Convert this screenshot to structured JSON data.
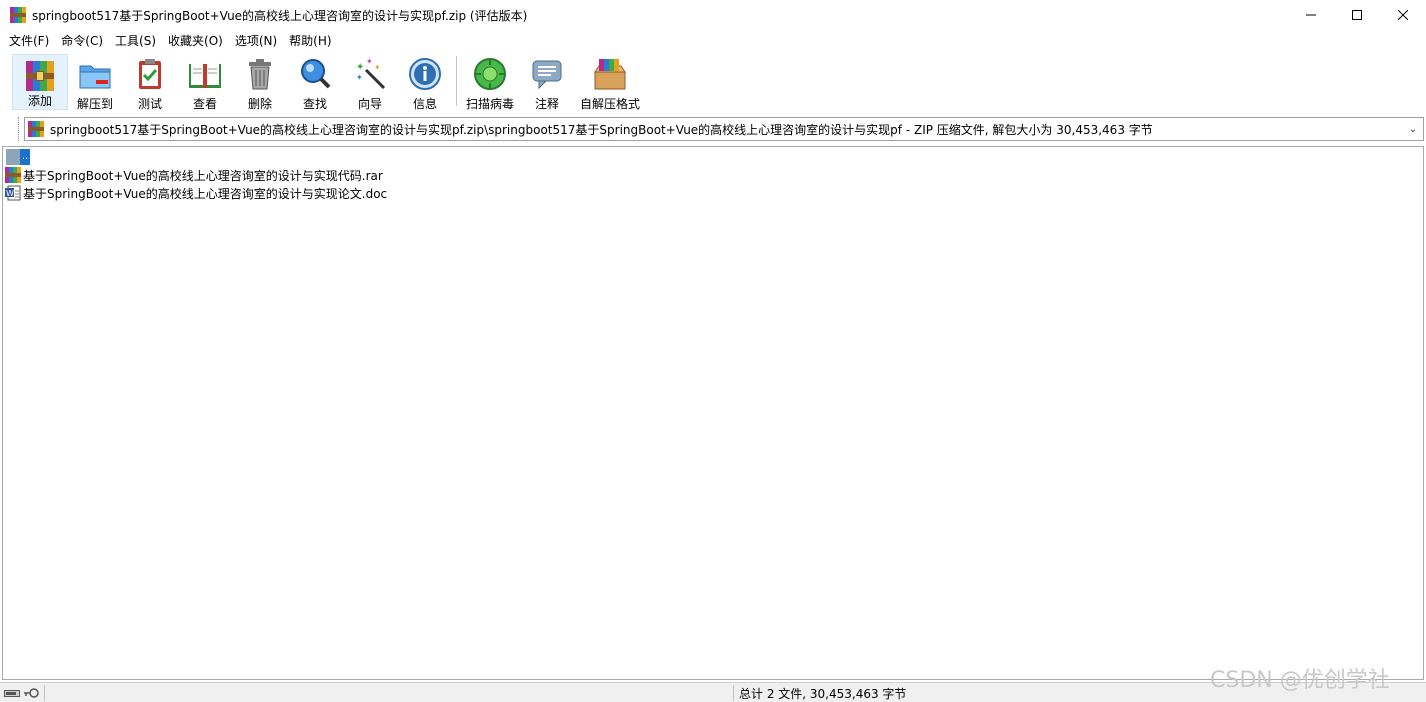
{
  "window": {
    "title": "springboot517基于SpringBoot+Vue的高校线上心理咨询室的设计与实现pf.zip (评估版本)",
    "minimize_glyph": "—",
    "maximize_glyph": "☐",
    "close_glyph": "✕"
  },
  "menu": [
    {
      "label": "文件(F)"
    },
    {
      "label": "命令(C)"
    },
    {
      "label": "工具(S)"
    },
    {
      "label": "收藏夹(O)"
    },
    {
      "label": "选项(N)"
    },
    {
      "label": "帮助(H)"
    }
  ],
  "toolbar": {
    "add": "添加",
    "extract_to": "解压到",
    "test": "测试",
    "view": "查看",
    "delete": "删除",
    "find": "查找",
    "wizard": "向导",
    "info": "信息",
    "virus_scan": "扫描病毒",
    "comment": "注释",
    "sfx": "自解压格式"
  },
  "address": {
    "path": "springboot517基于SpringBoot+Vue的高校线上心理咨询室的设计与实现pf.zip\\springboot517基于SpringBoot+Vue的高校线上心理咨询室的设计与实现pf - ZIP 压缩文件, 解包大小为 30,453,463 字节"
  },
  "files": [
    {
      "name": "基于SpringBoot+Vue的高校线上心理咨询室的设计与实现代码.rar",
      "icon": "rar-archive-icon"
    },
    {
      "name": "基于SpringBoot+Vue的高校线上心理咨询室的设计与实现论文.doc",
      "icon": "word-document-icon"
    }
  ],
  "updir_label": "..",
  "status": {
    "summary": "总计 2 文件, 30,453,463 字节"
  },
  "watermark": "CSDN @优创学社",
  "colors": {
    "selection_bg": "#e5f1fb",
    "updir_blue": "#1a73c8"
  }
}
